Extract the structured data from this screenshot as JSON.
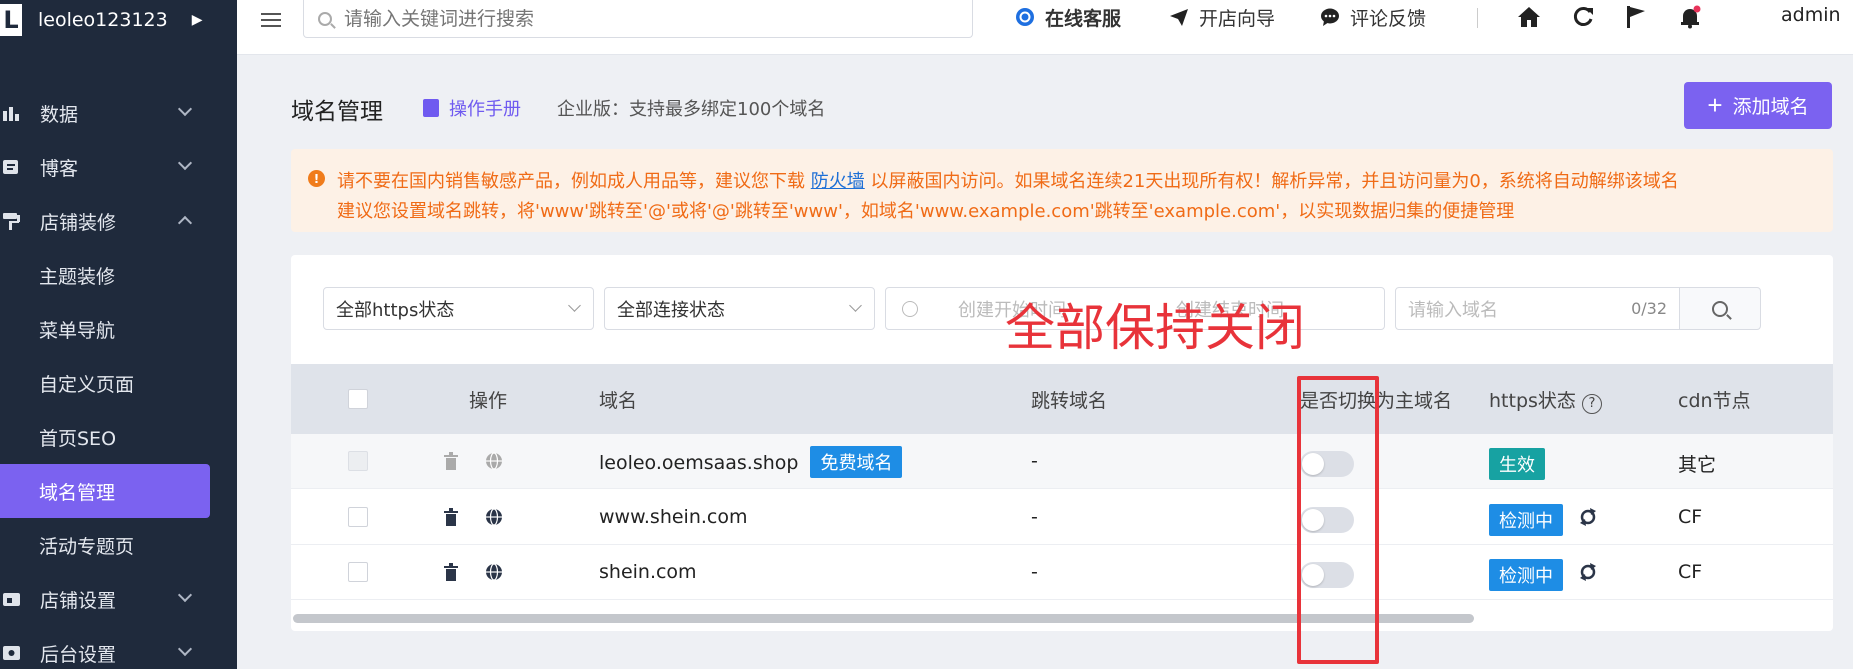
{
  "brand": {
    "logo": "L",
    "name": "leoleo123123"
  },
  "sidebar": {
    "groups": [
      {
        "label": "数据",
        "icon": "bar-chart-icon"
      },
      {
        "label": "博客",
        "icon": "edit-icon"
      },
      {
        "label": "店铺装修",
        "icon": "paint-roller-icon"
      }
    ],
    "sub_items": [
      "主题装修",
      "菜单导航",
      "自定义页面",
      "首页SEO",
      "域名管理",
      "活动专题页"
    ],
    "bottom_groups": [
      {
        "label": "店铺设置",
        "icon": "store-icon"
      },
      {
        "label": "后台设置",
        "icon": "settings-icon"
      }
    ],
    "active": "域名管理"
  },
  "topbar": {
    "search_placeholder": "请输入关键词进行搜索",
    "online_service": "在线客服",
    "store_guide": "开店向导",
    "feedback": "评论反馈",
    "user": "admin"
  },
  "page": {
    "title": "域名管理",
    "manual": "操作手册",
    "edition": "企业版：支持最多绑定100个域名",
    "add_button": "添加域名"
  },
  "warning": {
    "line1_a": "请不要在国内销售敏感产品，例如成人用品等，建议您下载 ",
    "line1_link": "防火墙",
    "line1_b": " 以屏蔽国内访问。如果域名连续21天出现所有权！解析异常，并且访问量为0，系统将自动解绑该域名",
    "line2": "建议您设置域名跳转，将'www'跳转至'@'或将'@'跳转至'www'，如域名'www.example.com'跳转至'example.com'，以实现数据归集的便捷管理"
  },
  "filters": {
    "https_status": "全部https状态",
    "connection_status": "全部连接状态",
    "start_time_placeholder": "创建开始时间",
    "end_time_placeholder": "创建结束时间",
    "domain_placeholder": "请输入域名",
    "domain_count": "0/32"
  },
  "annotation": "全部保持关闭",
  "table": {
    "headers": {
      "action": "操作",
      "domain": "域名",
      "redirect": "跳转域名",
      "switch_primary": "是否切换为主域名",
      "https": "https状态",
      "cdn": "cdn节点"
    },
    "rows": [
      {
        "domain": "leoleo.oemsaas.shop",
        "tag": "免费域名",
        "redirect": "-",
        "https": "生效",
        "https_color": "#17a2a2",
        "cdn": "其它",
        "switch_on": false
      },
      {
        "domain": "www.shein.com",
        "tag": "",
        "redirect": "-",
        "https": "检测中",
        "https_color": "#1e8de5",
        "cdn": "CF",
        "switch_on": false
      },
      {
        "domain": "shein.com",
        "tag": "",
        "redirect": "-",
        "https": "检测中",
        "https_color": "#1e8de5",
        "cdn": "CF",
        "switch_on": false
      }
    ]
  },
  "colors": {
    "accent": "#7b62f0",
    "warning_text": "#f06b16",
    "annotation": "#e8333a",
    "sidebar_bg": "#1f2a3c"
  }
}
